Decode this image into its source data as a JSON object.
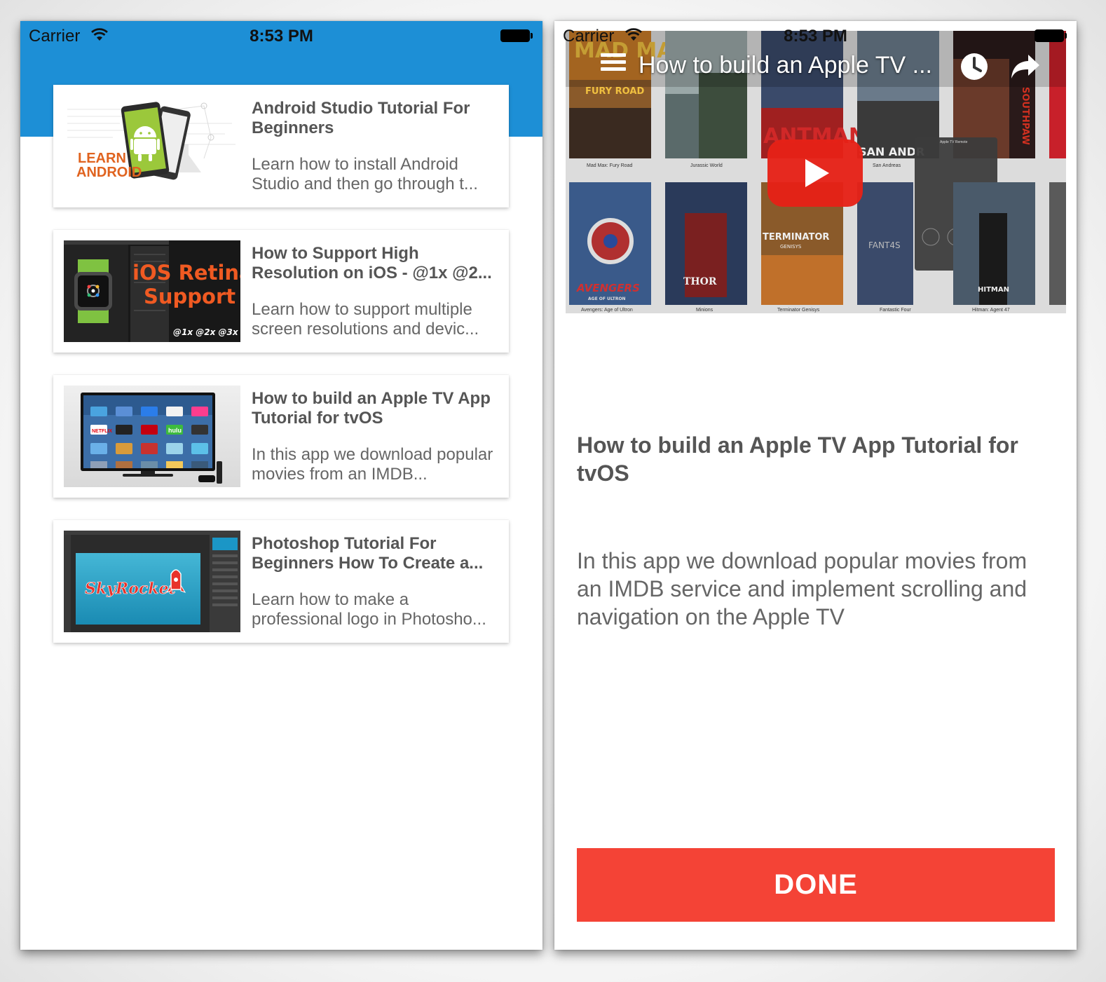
{
  "status_bar": {
    "carrier": "Carrier",
    "time": "8:53 PM"
  },
  "list_screen": {
    "header_color": "#1d8fd6",
    "items": [
      {
        "title": "Android Studio Tutorial For Beginners",
        "description": "Learn how to install Android Studio and then go through t...",
        "thumb_text": [
          "LEARN",
          "ANDROID"
        ]
      },
      {
        "title": "How to Support High Resolution on iOS - @1x @2...",
        "description": "Learn how to support multiple screen resolutions and devic...",
        "thumb_text": [
          "iOS Retina",
          "Support",
          "@1x @2x @3x"
        ]
      },
      {
        "title": "How to build an Apple TV App Tutorial for tvOS",
        "description": "In this app we download popular movies from an IMDB...",
        "thumb_text": [
          "NETFLIX",
          "hulu"
        ]
      },
      {
        "title": "Photoshop Tutorial For Beginners How To Create a...",
        "description": "Learn how to make a professional logo in Photosho...",
        "thumb_text": [
          "SkyRocket"
        ]
      }
    ]
  },
  "detail_screen": {
    "video": {
      "title": "How to build an Apple TV ...",
      "poster_labels": {
        "madmax": "MAD MAX",
        "madmax_sub": "FURY ROAD",
        "madmax_caption": "Mad Max: Fury Road",
        "jurassic_caption": "Jurassic World",
        "antman": "ANTMAN",
        "sanandreas": "SAN ANDR",
        "sanandreas_caption": "San Andreas",
        "southpaw": "SOUTHPAW",
        "remote_title": "Apple TV Remote",
        "avengers": "AVENGERS",
        "avengers_sub": "AGE OF ULTRON",
        "avengers_caption": "Avengers: Age of Ultron",
        "thor": "THOR",
        "thor_caption": "Minions",
        "terminator": "TERMINATOR",
        "terminator_sub": "GENISYS",
        "terminator_caption": "Terminator Genisys",
        "f4": "FANT4S",
        "f4_caption": "Fantastic Four",
        "hitman": "HITMAN",
        "hitman_caption": "Hitman: Agent 47"
      }
    },
    "title": "How to build an Apple TV App Tutorial for tvOS",
    "description": "In this app we download popular movies from an IMDB service and implement scrolling and navigation on the Apple TV",
    "done_label": "DONE",
    "done_color": "#f44336"
  }
}
